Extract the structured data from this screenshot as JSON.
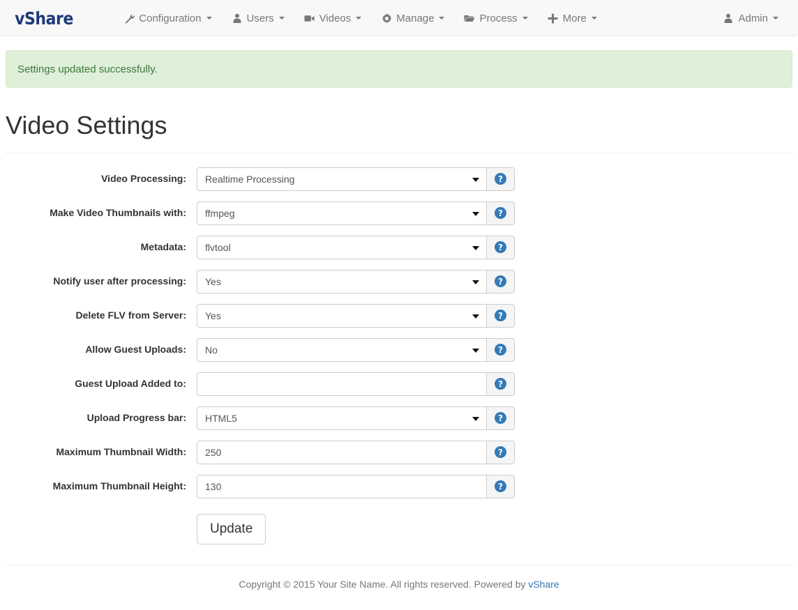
{
  "navbar": {
    "brand": "vShare",
    "items": [
      {
        "label": "Configuration",
        "icon": "wrench-icon",
        "caret": true
      },
      {
        "label": "Users",
        "icon": "user-icon",
        "caret": true
      },
      {
        "label": "Videos",
        "icon": "video-camera-icon",
        "caret": true
      },
      {
        "label": "Manage",
        "icon": "gear-icon",
        "caret": true
      },
      {
        "label": "Process",
        "icon": "folder-open-icon",
        "caret": true
      },
      {
        "label": "More",
        "icon": "plus-icon",
        "caret": true
      }
    ],
    "right": {
      "label": "Admin",
      "icon": "user-icon",
      "caret": true
    }
  },
  "alert": {
    "message": "Settings updated successfully.",
    "bg": "#dff0d8",
    "border": "#d6e9c6",
    "text_color": "#3c763d"
  },
  "page": {
    "title": "Video Settings"
  },
  "form": {
    "rows": [
      {
        "label": "Video Processing:",
        "type": "select",
        "value": "Realtime Processing",
        "help": "?"
      },
      {
        "label": "Make Video Thumbnails with:",
        "type": "select",
        "value": "ffmpeg",
        "help": "?"
      },
      {
        "label": "Metadata:",
        "type": "select",
        "value": "flvtool",
        "help": "?"
      },
      {
        "label": "Notify user after processing:",
        "type": "select",
        "value": "Yes",
        "help": "?"
      },
      {
        "label": "Delete FLV from Server:",
        "type": "select",
        "value": "Yes",
        "help": "?"
      },
      {
        "label": "Allow Guest Uploads:",
        "type": "select",
        "value": "No",
        "help": "?"
      },
      {
        "label": "Guest Upload Added to:",
        "type": "text",
        "value": "",
        "help": "?"
      },
      {
        "label": "Upload Progress bar:",
        "type": "select",
        "value": "HTML5",
        "help": "?"
      },
      {
        "label": "Maximum Thumbnail Width:",
        "type": "text",
        "value": "250",
        "help": "?"
      },
      {
        "label": "Maximum Thumbnail Height:",
        "type": "text",
        "value": "130",
        "help": "?"
      }
    ],
    "submit_label": "Update"
  },
  "footer": {
    "text": "Copyright © 2015 Your Site Name. All rights reserved. Powered by ",
    "link_label": "vShare",
    "link_color": "#337ab7"
  }
}
